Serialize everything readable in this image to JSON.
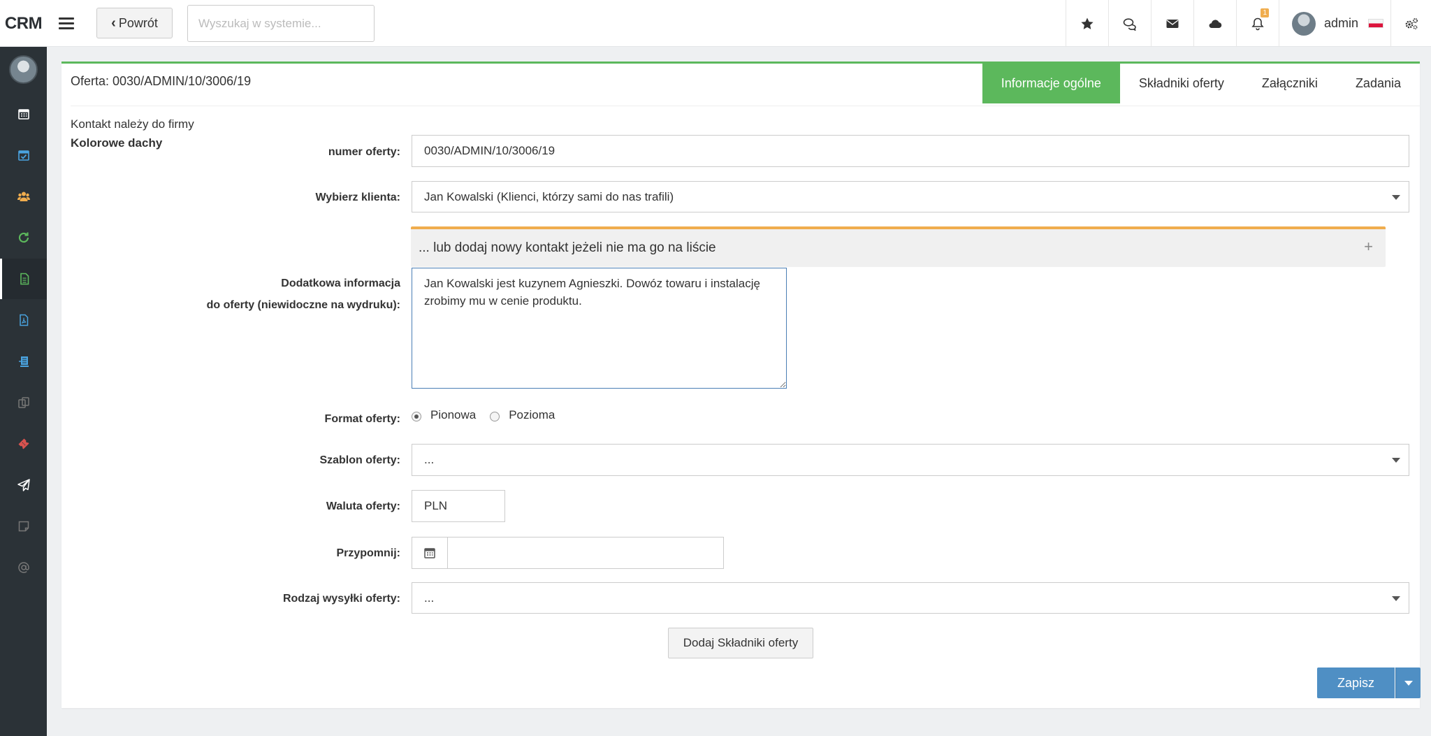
{
  "app": {
    "brand": "CRM"
  },
  "header": {
    "back_label": "Powrót",
    "search_placeholder": "Wyszukaj w systemie...",
    "notifications_count": "1",
    "user_name": "admin",
    "icons": [
      "star-icon",
      "comments-icon",
      "envelope-icon",
      "cloud-icon",
      "bell-icon",
      "settings-icon"
    ]
  },
  "sidebar": {
    "items": [
      "calendar-icon",
      "calendar-check-icon",
      "users-icon",
      "refresh-icon",
      "document-icon",
      "pdf-icon",
      "stamp-icon",
      "copy-icon",
      "ticket-icon",
      "send-icon",
      "note-icon",
      "at-icon"
    ],
    "active_index": 4
  },
  "offer": {
    "title": "Oferta: 0030/ADMIN/10/3006/19",
    "tabs": [
      "Informacje ogólne",
      "Składniki oferty",
      "Załączniki",
      "Zadania"
    ],
    "active_tab": 0,
    "company_note": "Kontakt należy do firmy",
    "company_name": "Kolorowe dachy"
  },
  "form": {
    "offer_number": {
      "label": "numer oferty:",
      "value": "0030/ADMIN/10/3006/19"
    },
    "client": {
      "label": "Wybierz klienta:",
      "value": "Jan Kowalski (Klienci, którzy sami do nas trafili)"
    },
    "add_contact": {
      "label": "... lub dodaj nowy kontakt jeżeli nie ma go na liście",
      "icon": "+"
    },
    "extra_info": {
      "label_line1": "Dodatkowa informacja",
      "label_line2": "do oferty (niewidoczne na wydruku):",
      "value": "Jan Kowalski jest kuzynem Agnieszki.  Dowóz towaru i instalację zrobimy mu w cenie produktu."
    },
    "format": {
      "label": "Format oferty:",
      "options": [
        "Pionowa",
        "Pozioma"
      ],
      "selected": "Pionowa"
    },
    "template": {
      "label": "Szablon oferty:",
      "value": "..."
    },
    "currency": {
      "label": "Waluta oferty:",
      "value": "PLN"
    },
    "remind": {
      "label": "Przypomnij:",
      "value": ""
    },
    "shipping": {
      "label": "Rodzaj wysyłki oferty:",
      "value": "..."
    },
    "add_items_label": "Dodaj Składniki oferty",
    "save_label": "Zapisz"
  },
  "colors": {
    "accent_green": "#5cb85c",
    "primary_blue": "#4f8fc4",
    "warning_orange": "#f0ad4e",
    "sidebar_bg": "#2b3237"
  }
}
